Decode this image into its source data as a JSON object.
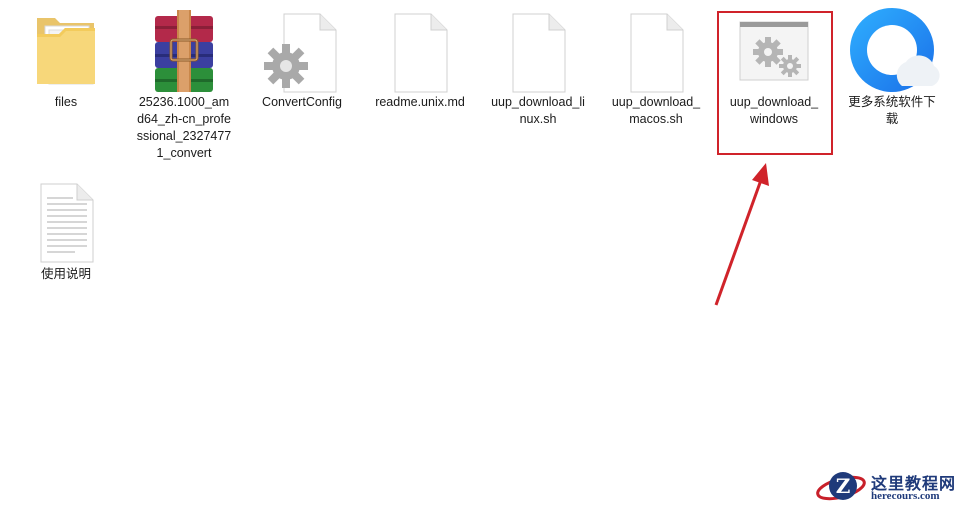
{
  "files": [
    {
      "name": "files",
      "type": "folder"
    },
    {
      "name": "25236.1000_amd64_zh-cn_professional_23274771_convert",
      "type": "archive"
    },
    {
      "name": "ConvertConfig",
      "type": "config"
    },
    {
      "name": "readme.unix.md",
      "type": "document"
    },
    {
      "name": "uup_download_linux.sh",
      "type": "document"
    },
    {
      "name": "uup_download_macos.sh",
      "type": "document"
    },
    {
      "name": "uup_download_windows",
      "type": "batch-script"
    },
    {
      "name": "更多系统软件下载",
      "type": "browser-shortcut"
    },
    {
      "name": "使用说明",
      "type": "text-document"
    }
  ],
  "highlight_color": "#d0232a",
  "watermark": {
    "title": "这里教程网",
    "url": "herecours.com"
  }
}
